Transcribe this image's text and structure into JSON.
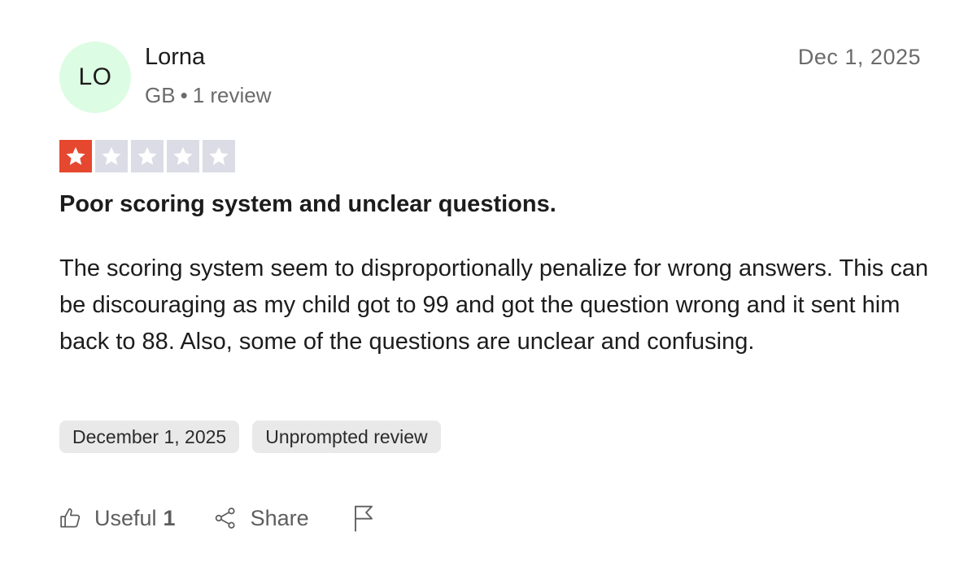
{
  "reviewer": {
    "initials": "LO",
    "name": "Lorna",
    "country": "GB",
    "separator": "•",
    "review_count": "1 review"
  },
  "review": {
    "date": "Dec 1, 2025",
    "rating": 1,
    "rating_max": 5,
    "title": "Poor scoring system and unclear questions.",
    "body": "The scoring system seem to disproportionally penalize for wrong answers. This can be discouraging as my child got to 99 and got the question wrong and it sent him back to 88. Also, some of the questions are unclear and confusing."
  },
  "tags": {
    "experience_date": "December 1, 2025",
    "review_type": "Unprompted review"
  },
  "actions": {
    "useful_label": "Useful",
    "useful_count": "1",
    "share_label": "Share"
  },
  "colors": {
    "avatar_bg": "#dcfce3",
    "star_filled": "#e5482f",
    "star_empty": "#dcdce6"
  },
  "icons": {
    "useful": "thumbs-up-icon",
    "share": "share-icon",
    "report": "flag-icon"
  }
}
